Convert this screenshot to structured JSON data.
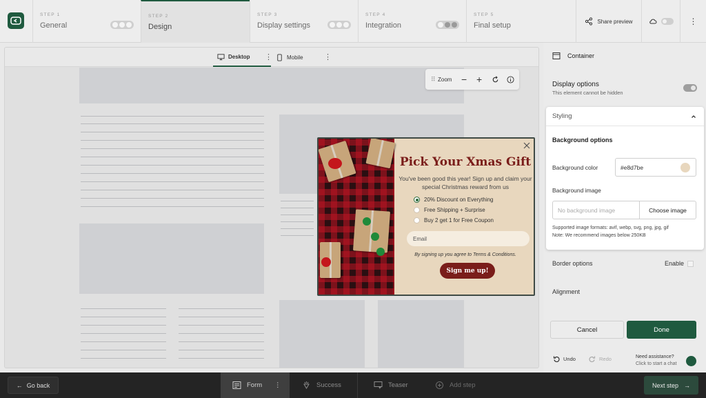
{
  "topbar": {
    "steps": [
      {
        "num": "STEP 1",
        "name": "General"
      },
      {
        "num": "STEP 2",
        "name": "Design"
      },
      {
        "num": "STEP 3",
        "name": "Display settings"
      },
      {
        "num": "STEP 4",
        "name": "Integration"
      },
      {
        "num": "STEP 5",
        "name": "Final setup"
      }
    ],
    "share_label": "Share preview"
  },
  "canvas": {
    "devices": {
      "desktop": "Desktop",
      "mobile": "Mobile"
    },
    "zoom_label": "Zoom"
  },
  "popup": {
    "title": "Pick Your Xmas Gift",
    "subtitle": "You've been good this year! Sign up and claim your special Christmas reward from us",
    "options": [
      "20% Discount on Everything",
      "Free Shipping + Surprise",
      "Buy 2 get 1 for Free Coupon"
    ],
    "selected_option": 0,
    "email_placeholder": "Email",
    "terms": "By signing up you agree to Terms & Conditions.",
    "cta": "Sign me up!",
    "bg_color": "#e8d7be",
    "cta_color": "#7a1d1a"
  },
  "panel": {
    "title": "Container",
    "display_title": "Display options",
    "display_sub": "This element cannot be hidden",
    "styling": {
      "header": "Styling",
      "bg_options": "Background options",
      "bg_color_label": "Background color",
      "bg_color_value": "#e8d7be",
      "bg_image_label": "Background image",
      "bg_image_placeholder": "No background image",
      "choose_image": "Choose image",
      "note_formats": "Supported image formats: avif, webp, svg, png, jpg, gif",
      "note_size": "Note: We recommend images below 250KB"
    },
    "border_options": "Border options",
    "enable_label": "Enable",
    "alignment": "Alignment",
    "cancel": "Cancel",
    "done": "Done",
    "undo": "Undo",
    "redo": "Redo",
    "assist_title": "Need assistance?",
    "assist_sub": "Click to start a chat"
  },
  "bottombar": {
    "go_back": "Go back",
    "tabs": [
      "Form",
      "Success",
      "Teaser",
      "Add step"
    ],
    "next_step": "Next step"
  }
}
